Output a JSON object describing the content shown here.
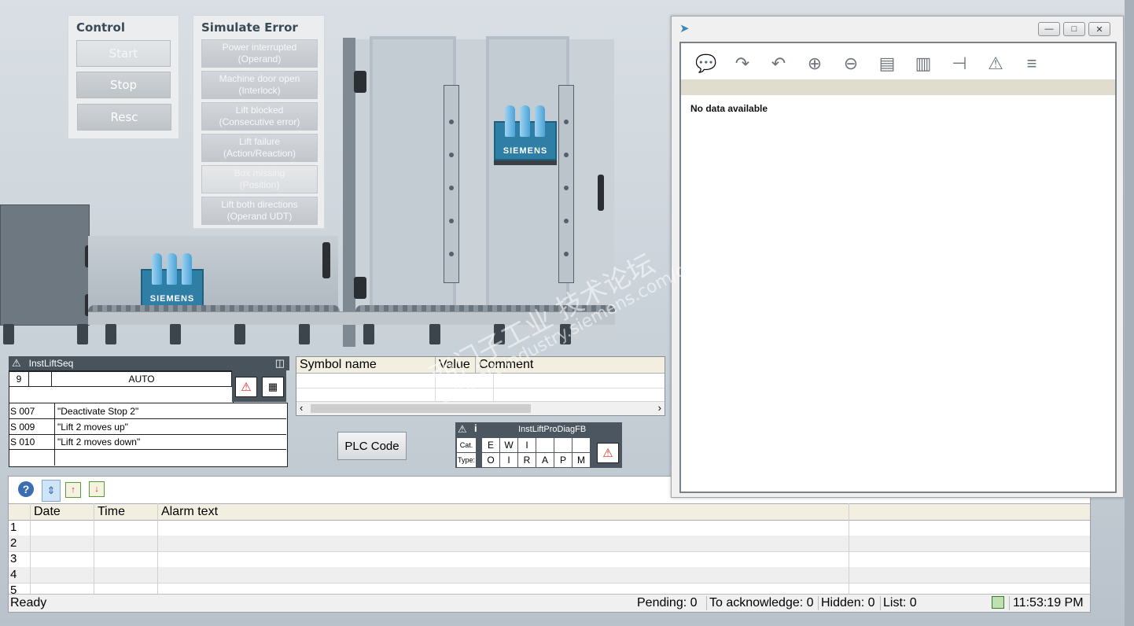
{
  "control": {
    "title": "Control",
    "buttons": {
      "start": "Start",
      "stop": "Stop",
      "resc": "Resc"
    }
  },
  "simulate": {
    "title": "Simulate Error",
    "buttons": [
      {
        "line1": "Power interrupted",
        "line2": "(Operand)"
      },
      {
        "line1": "Machine door open",
        "line2": "(Interlock)"
      },
      {
        "line1": "Lift blocked",
        "line2": "(Consecutive error)"
      },
      {
        "line1": "Lift failure",
        "line2": "(Action/Reaction)"
      },
      {
        "line1": "Box missing",
        "line2": "(Position)"
      },
      {
        "line1": "Lift both directions",
        "line2": "(Operand UDT)"
      }
    ]
  },
  "machine": {
    "crate_brand": "SIEMENS"
  },
  "faceplate": {
    "title": "InstLiftSeq",
    "step_number": "9",
    "mode": "AUTO",
    "steps": [
      {
        "id": "S 007",
        "text": "\"Deactivate Stop 2\""
      },
      {
        "id": "S 009",
        "text": "\"Lift 2 moves up\""
      },
      {
        "id": "S 010",
        "text": "\"Lift 2 moves down\""
      }
    ]
  },
  "symbol_table": {
    "headers": {
      "symbol": "Symbol name",
      "value": "Value",
      "comment": "Comment"
    }
  },
  "plc_code_button": "PLC Code",
  "prodiag": {
    "title": "InstLiftProDiagFB",
    "cat_label": "Cat.",
    "type_label": "Type:",
    "cat": [
      "E",
      "W",
      "I",
      "",
      "",
      ""
    ],
    "type": [
      "O",
      "I",
      "R",
      "A",
      "P",
      "M"
    ]
  },
  "alarm_view": {
    "headers": {
      "date": "Date",
      "time": "Time",
      "text": "Alarm text"
    },
    "rows": [
      "1",
      "2",
      "3",
      "4",
      "5"
    ],
    "status": {
      "ready": "Ready",
      "pending": "Pending: 0",
      "to_ack": "To acknowledge: 0",
      "hidden": "Hidden: 0",
      "list": "List: 0",
      "time": "11:53:19 PM"
    }
  },
  "diag_window": {
    "empty_text": "No data available",
    "toolbar_icons": [
      "comment-icon",
      "forward-icon",
      "back-icon",
      "zoom-in-icon",
      "zoom-out-icon",
      "search-network-icon",
      "network-hand-icon",
      "add-operand-icon",
      "glasses-warning-icon",
      "delete-lines-icon"
    ]
  },
  "watermark": {
    "line1": "西门子工业 技术论坛",
    "line2": "support.industry.siemens.com/cs"
  }
}
